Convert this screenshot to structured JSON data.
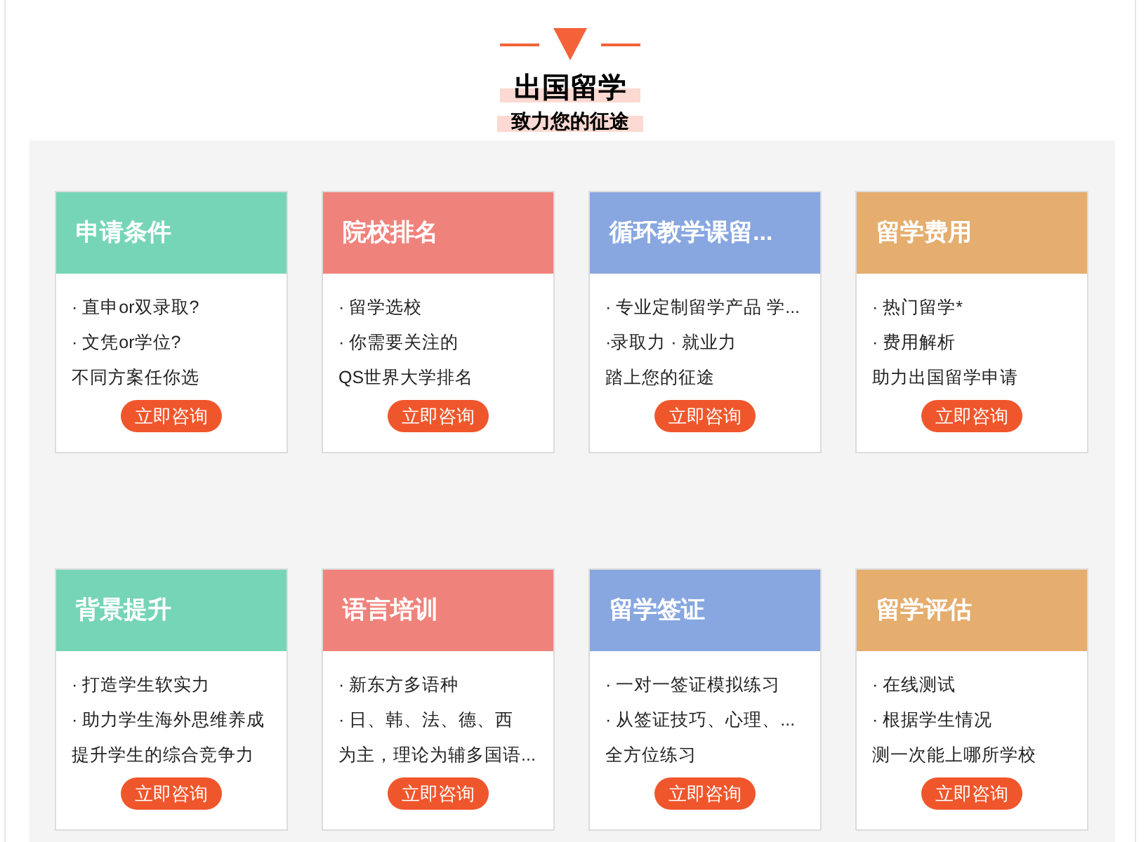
{
  "heading": {
    "title": "出国留学",
    "subtitle": "致力您的征途"
  },
  "cards": [
    {
      "title": "申请条件",
      "color": "#76d5b6",
      "lines": [
        "· 直申or双录取?",
        "· 文凭or学位?",
        "不同方案任你选"
      ],
      "button": "立即咨询"
    },
    {
      "title": "院校排名",
      "color": "#f0827c",
      "lines": [
        "· 留学选校",
        "· 你需要关注的",
        "QS世界大学排名"
      ],
      "button": "立即咨询"
    },
    {
      "title": "循环教学课留...",
      "color": "#88a7e0",
      "lines": [
        "· 专业定制留学产品 学...",
        "·录取力 · 就业力",
        "踏上您的征途"
      ],
      "button": "立即咨询"
    },
    {
      "title": "留学费用",
      "color": "#e5ad6e",
      "lines": [
        "· 热门留学*",
        "· 费用解析",
        "助力出国留学申请"
      ],
      "button": "立即咨询"
    },
    {
      "title": "背景提升",
      "color": "#76d5b6",
      "lines": [
        "· 打造学生软实力",
        "· 助力学生海外思维养成",
        "提升学生的综合竞争力"
      ],
      "button": "立即咨询"
    },
    {
      "title": "语言培训",
      "color": "#f0827c",
      "lines": [
        "· 新东方多语种",
        "· 日、韩、法、德、西",
        "为主，理论为辅多国语..."
      ],
      "button": "立即咨询"
    },
    {
      "title": "留学签证",
      "color": "#88a7e0",
      "lines": [
        "· 一对一签证模拟练习",
        "· 从签证技巧、心理、...",
        "全方位练习"
      ],
      "button": "立即咨询"
    },
    {
      "title": "留学评估",
      "color": "#e5ad6e",
      "lines": [
        "· 在线测试",
        "· 根据学生情况",
        "测一次能上哪所学校"
      ],
      "button": "立即咨询"
    }
  ]
}
